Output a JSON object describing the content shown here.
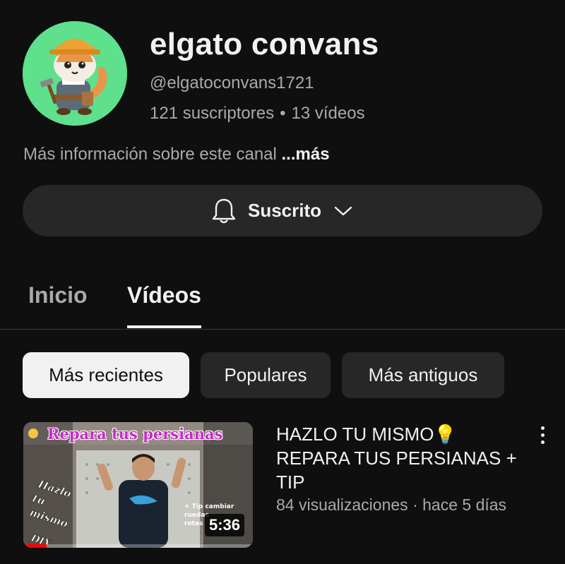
{
  "channel": {
    "name": "elgato convans",
    "handle": "@elgatoconvans1721",
    "subscribers": "121 suscriptores",
    "separator": "•",
    "videos_count": "13 vídeos",
    "about": "Más información sobre este canal",
    "about_more": "...más",
    "avatar_icon": "cat-builder-avatar",
    "avatar_bg": "#5ee08c"
  },
  "subscribe": {
    "label": "Suscrito",
    "bell_icon": "bell-icon",
    "chevron_icon": "chevron-down-icon"
  },
  "tabs": [
    {
      "label": "Inicio",
      "active": false
    },
    {
      "label": "Vídeos",
      "active": true
    }
  ],
  "filters": [
    {
      "label": "Más recientes",
      "active": true
    },
    {
      "label": "Populares",
      "active": false
    },
    {
      "label": "Más antiguos",
      "active": false
    }
  ],
  "videos": [
    {
      "thumbnail_title": "Repara tus persianas",
      "duration": "5:36",
      "title": "HAZLO TU MISMO💡 REPARA TUS PERSIANAS + TIP",
      "views": "84 visualizaciones",
      "meta_separator": "·",
      "age": "hace 5 días",
      "progress_fraction": 0.1,
      "thumbnail_overlay_left": "Hazlo tu mismo DIY",
      "thumbnail_overlay_right": "+ Tip cambiar ruedas rotas"
    }
  ],
  "colors": {
    "background": "#0f0f0f",
    "chip": "#272727",
    "chip_active": "#f1f1f1",
    "secondary_text": "#aaaaaa",
    "progress": "#ff0000"
  }
}
